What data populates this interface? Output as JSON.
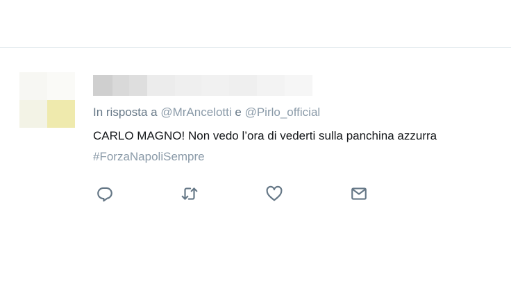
{
  "tweet": {
    "reply_prefix": "In risposta a",
    "mentions": [
      "@MrAncelotti",
      "@Pirlo_official"
    ],
    "conjunction": "e",
    "text": "CARLO MAGNO! Non vedo l’ora di vederti sulla panchina azzurra",
    "hashtag": "#ForzaNapoliSempre"
  },
  "actions": {
    "reply_icon": "reply-icon",
    "retweet_icon": "retweet-icon",
    "like_icon": "heart-icon",
    "dm_icon": "mail-icon"
  },
  "colors": {
    "secondary_text": "#657786",
    "primary_text": "#14171a",
    "link_muted": "#8a9aa8",
    "avatar_tint": "#efeaad"
  }
}
